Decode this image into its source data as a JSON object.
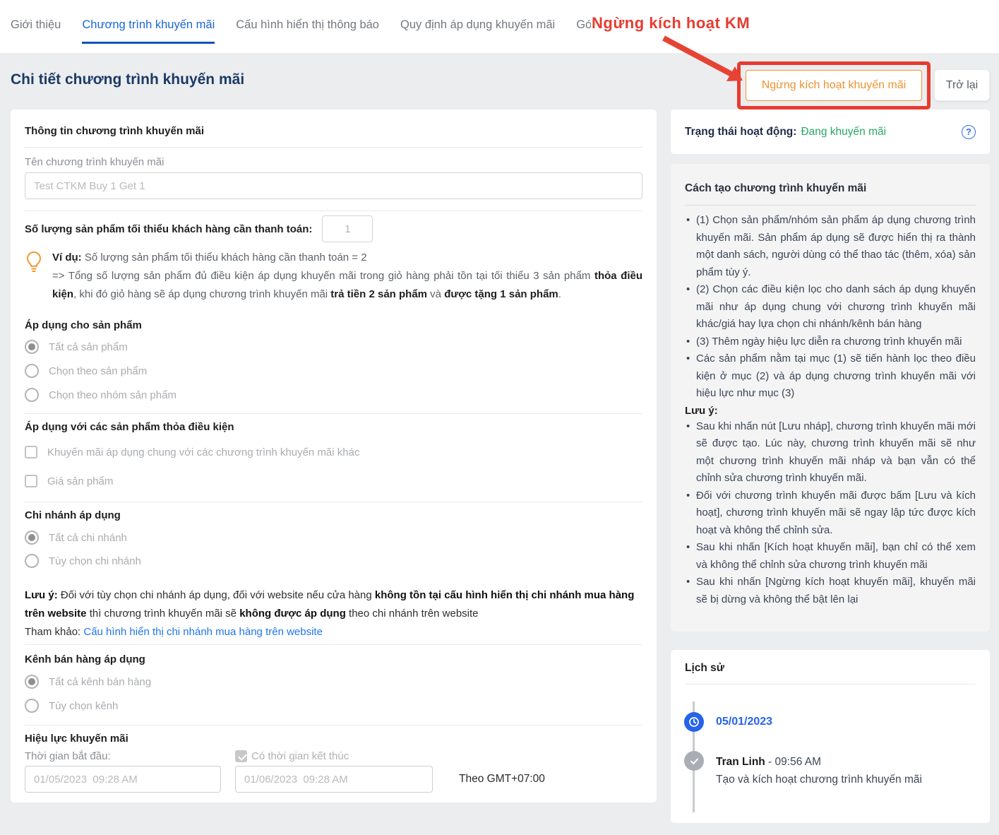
{
  "tabs": [
    {
      "label": "Giới thiệu",
      "active": false
    },
    {
      "label": "Chương trình khuyến mãi",
      "active": true
    },
    {
      "label": "Cấu hình hiển thị thông báo",
      "active": false
    },
    {
      "label": "Quy định áp dụng khuyến mãi",
      "active": false
    },
    {
      "label": "Gó",
      "active": false
    }
  ],
  "annotation": {
    "label": "Ngừng kích hoạt KM"
  },
  "page": {
    "title": "Chi tiết chương trình khuyến mãi"
  },
  "actions": {
    "deactivate_label": "Ngừng kích hoạt khuyến mãi",
    "back_label": "Trở lại"
  },
  "status": {
    "label": "Trạng thái hoạt động:",
    "value": "Đang khuyến mãi",
    "help_glyph": "?"
  },
  "form": {
    "section_title": "Thông tin chương trình khuyến mãi",
    "name": {
      "label": "Tên chương trình khuyến mãi",
      "value": "Test CTKM Buy 1 Get 1"
    },
    "min_qty": {
      "label": "Số lượng sản phẩm tối thiểu khách hàng cần thanh toán:",
      "value": "1"
    },
    "example": {
      "tag": "Ví dụ:",
      "line1": " Số lượng sản phẩm tối thiểu khách hàng cần thanh toán = 2",
      "t1": "=> Tổng số lượng sản phẩm đủ điều kiện áp dụng khuyến mãi trong giỏ hàng phải tồn tại tối thiểu 3 sản phẩm ",
      "b1": "thỏa điều kiện",
      "t2": ", khi đó giỏ hàng sẽ áp dụng chương trình khuyến mãi ",
      "b2": "trả tiền 2 sản phẩm",
      "t3": " và ",
      "b3": "được tặng 1 sản phẩm",
      "t4": "."
    },
    "product_scope": {
      "title": "Áp dụng cho sản phẩm",
      "options": [
        {
          "label": "Tất cả sản phẩm",
          "checked": true
        },
        {
          "label": "Chọn theo sản phẩm",
          "checked": false
        },
        {
          "label": "Chọn theo nhóm sản phẩm",
          "checked": false
        }
      ]
    },
    "conditions": {
      "title": "Áp dụng với các sản phẩm thỏa điều kiện",
      "options": [
        {
          "label": "Khuyến mãi áp dụng chung với các chương trình khuyến mãi khác",
          "checked": false
        },
        {
          "label": "Giá sản phẩm",
          "checked": false
        }
      ]
    },
    "branch": {
      "title": "Chi nhánh áp dụng",
      "options": [
        {
          "label": "Tất cả chi nhánh",
          "checked": true
        },
        {
          "label": "Tùy chọn chi nhánh",
          "checked": false
        }
      ],
      "note": {
        "tag": "Lưu ý:",
        "t1": " Đối với tùy chọn chi nhánh áp dụng, đối với website nếu cửa hàng ",
        "b1": "không tồn tại cấu hình hiển thị chi nhánh mua hàng trên website",
        "t2": " thì chương trình khuyến mãi sẽ ",
        "b2": "không được áp dụng",
        "t3": " theo chi nhánh trên website",
        "ref_label": "Tham khảo: ",
        "ref_link": "Cấu hình hiển thị chi nhánh mua hàng trên website"
      }
    },
    "channel": {
      "title": "Kênh bán hàng áp dụng",
      "options": [
        {
          "label": "Tất cả kênh bán hàng",
          "checked": true
        },
        {
          "label": "Tùy chọn kênh",
          "checked": false
        }
      ]
    },
    "validity": {
      "title": "Hiệu lực khuyến mãi",
      "start_label": "Thời gian bắt đầu:",
      "start_value": "01/05/2023  09:28 AM",
      "end_checkbox_label": "Có thời gian kết thúc",
      "end_checked": true,
      "end_value": "01/06/2023  09:28 AM",
      "timezone": "Theo GMT+07:00"
    }
  },
  "guide": {
    "title": "Cách tạo chương trình khuyến mãi",
    "bullets": [
      "(1) Chọn sản phẩm/nhóm sản phẩm áp dụng chương trình khuyến mãi. Sản phẩm áp dụng sẽ được hiển thị ra thành một danh sách, người dùng có thể thao tác (thêm, xóa) sản phẩm tùy ý.",
      "(2) Chọn các điều kiện lọc cho danh sách áp dụng khuyến mãi như áp dụng chung với chương trình khuyến mãi khác/giá hay lựa chọn chi nhánh/kênh bán hàng",
      "(3) Thêm ngày hiệu lực diễn ra chương trình khuyến mãi",
      "Các sản phẩm nằm tại mục (1) sẽ tiến hành lọc theo điều kiện ở mục (2) và áp dụng chương trình khuyến mãi với hiệu lực như mục (3)"
    ],
    "note_title": "Lưu ý:",
    "note_bullets": [
      "Sau khi nhấn nút [Lưu nháp], chương trình khuyến mãi mới sẽ được tạo. Lúc này, chương trình khuyến mãi sẽ như một chương trình khuyến mãi nháp và bạn vẫn có thể chỉnh sửa chương trình khuyến mãi.",
      "Đối với chương trình khuyến mãi được bấm [Lưu và kích hoạt], chương trình khuyến mãi sẽ ngay lập tức được kích hoạt và không thể chỉnh sửa.",
      "Sau khi nhấn [Kích hoạt khuyến mãi], bạn chỉ có thể xem và không thể chỉnh sửa chương trình khuyến mãi",
      "Sau khi nhấn [Ngừng kích hoạt khuyến mãi], khuyến mãi sẽ bị dừng và không thể bật lên lại"
    ]
  },
  "history": {
    "title": "Lịch sử",
    "entries": [
      {
        "date": "05/01/2023",
        "user": "Tran Linh",
        "time": " - 09:56 AM",
        "action": "Tạo và kích hoạt chương trình khuyến mãi"
      }
    ]
  },
  "colors": {
    "accent_blue": "#1a66d6",
    "title_navy": "#1b3a66",
    "orange": "#ed9332",
    "green": "#27a763",
    "annotation_red": "#e63c30",
    "link_blue": "#2176e6",
    "timeline_blue": "#2563eb"
  }
}
